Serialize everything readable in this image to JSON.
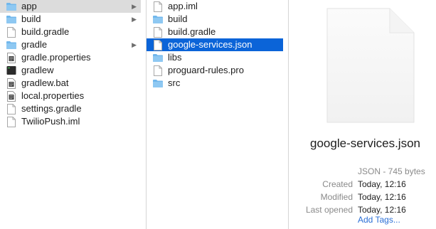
{
  "columns": [
    {
      "items": [
        {
          "label": "app",
          "icon": "folder-icon",
          "chevron": true,
          "selected": "inactive"
        },
        {
          "label": "build",
          "icon": "folder-icon",
          "chevron": true
        },
        {
          "label": "build.gradle",
          "icon": "document-icon"
        },
        {
          "label": "gradle",
          "icon": "folder-icon",
          "chevron": true
        },
        {
          "label": "gradle.properties",
          "icon": "properties-file-icon"
        },
        {
          "label": "gradlew",
          "icon": "unix-executable-icon"
        },
        {
          "label": "gradlew.bat",
          "icon": "properties-file-icon"
        },
        {
          "label": "local.properties",
          "icon": "properties-file-icon"
        },
        {
          "label": "settings.gradle",
          "icon": "document-icon"
        },
        {
          "label": "TwilioPush.iml",
          "icon": "document-icon"
        }
      ]
    },
    {
      "items": [
        {
          "label": "app.iml",
          "icon": "document-icon"
        },
        {
          "label": "build",
          "icon": "folder-icon"
        },
        {
          "label": "build.gradle",
          "icon": "document-icon"
        },
        {
          "label": "google-services.json",
          "icon": "document-icon",
          "selected": "active"
        },
        {
          "label": "libs",
          "icon": "folder-icon"
        },
        {
          "label": "proguard-rules.pro",
          "icon": "document-icon"
        },
        {
          "label": "src",
          "icon": "folder-icon"
        }
      ]
    }
  ],
  "preview": {
    "filename": "google-services.json",
    "kind": "JSON - 745 bytes",
    "created_label": "Created",
    "created_value": "Today, 12:16",
    "modified_label": "Modified",
    "modified_value": "Today, 12:16",
    "last_opened_label": "Last opened",
    "last_opened_value": "Today, 12:16",
    "add_tags": "Add Tags..."
  },
  "colors": {
    "selection_active": "#0b64d8",
    "selection_inactive": "#dcdcdc",
    "folder": "#71b7ec",
    "link": "#2a6fd6"
  }
}
